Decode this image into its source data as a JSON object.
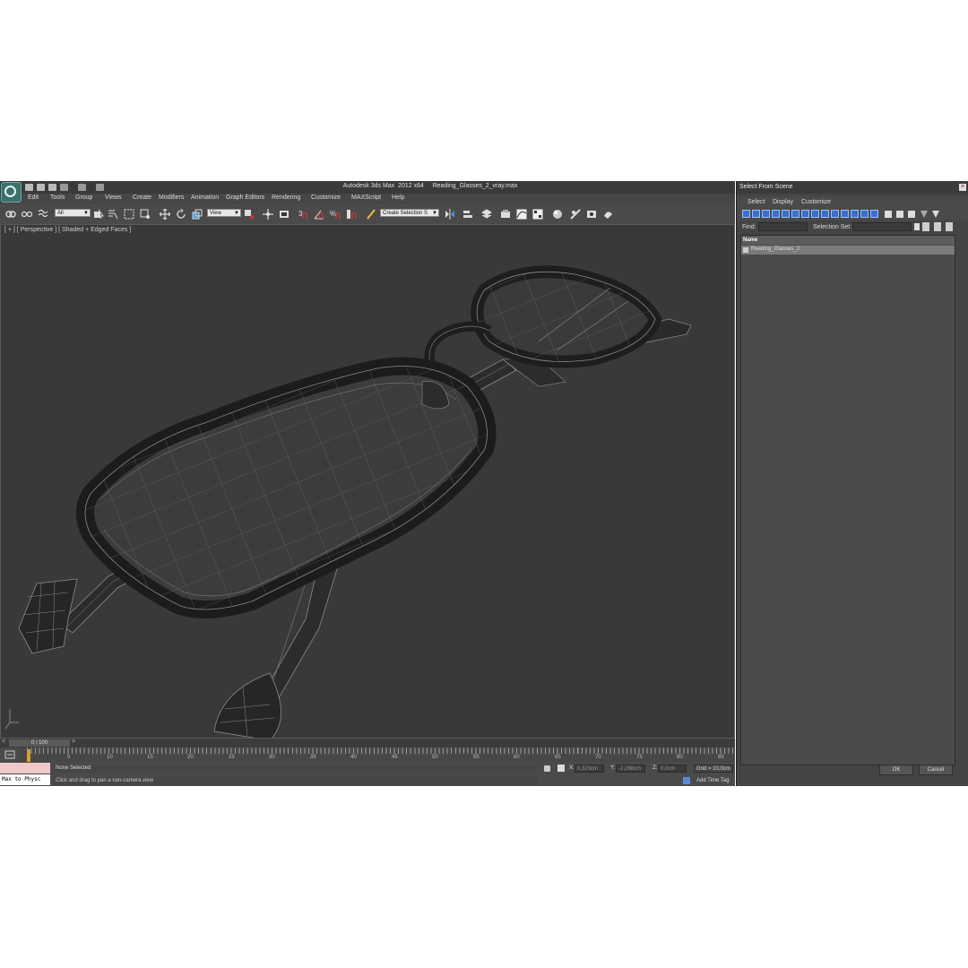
{
  "app": {
    "title": "Autodesk 3ds Max  2012 x64     Reading_Glasses_2_vray.max",
    "menu": [
      "Edit",
      "Tools",
      "Group",
      "Views",
      "Create",
      "Modifiers",
      "Animation",
      "Graph Editors",
      "Rendering",
      "Customize",
      "MAXScript",
      "Help"
    ],
    "toolbar": {
      "selection_filter": "All",
      "reference_coord": "View",
      "named_selection": "Create Selection S",
      "snap_labels": [
        "3",
        "%"
      ]
    },
    "viewport": {
      "label": "[ + ] [ Perspective ] [ Shaded + Edged Faces ]"
    },
    "timeline": {
      "frame_display": "0 / 100",
      "ticks": [
        "0",
        "5",
        "10",
        "15",
        "20",
        "25",
        "30",
        "35",
        "40",
        "45",
        "50",
        "55",
        "60",
        "65",
        "70",
        "75",
        "80",
        "85"
      ]
    },
    "status": {
      "selection": "None Selected",
      "prompt": "Click and drag to pan a non-camera view",
      "x_label": "X:",
      "x_value": "0,323cm",
      "y_label": "Y:",
      "y_value": "-2,268cm",
      "z_label": "Z:",
      "z_value": "0,0cm",
      "grid": "Grid = 10,0cm",
      "add_time_tag": "Add Time Tag",
      "maxscript_line": "Max to Physc"
    }
  },
  "dialog": {
    "title": "Select From Scene",
    "close_glyph": "×",
    "menu": [
      "Select",
      "Display",
      "Customize"
    ],
    "find_label": "Find:",
    "selection_set_label": "Selection Set:",
    "column_header": "Name",
    "items": [
      "Reading_Glasses_2"
    ],
    "ok_label": "OK",
    "cancel_label": "Cancel"
  },
  "colors": {
    "viewport_bg": "#393939",
    "ui_bg": "#444444",
    "selection_blue": "#3a6fd0",
    "wire": "#8c8c8c",
    "frame_fill": "#262626"
  }
}
